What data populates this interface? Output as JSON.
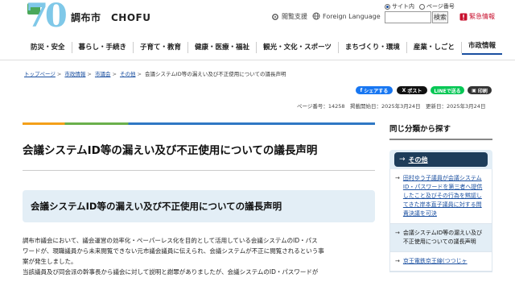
{
  "header": {
    "logo_number": "70",
    "city_name": "調布市　CHOFU",
    "radio_site": "サイト内",
    "radio_page": "ページ番号",
    "reading_support": "閲覧支援",
    "foreign_language": "Foreign Language",
    "search_placeholder": "",
    "search_button": "検索",
    "emergency": "緊急情報"
  },
  "gnav": {
    "items": [
      "防災・安全",
      "暮らし・手続き",
      "子育て・教育",
      "健康・医療・福祉",
      "観光・文化・スポーツ",
      "まちづくり・環境",
      "産業・しごと",
      "市政情報"
    ]
  },
  "breadcrumb": {
    "items": [
      "トップページ",
      "市政情報",
      "市議会",
      "その他"
    ],
    "current": "会議システムID等の漏えい及び不正使用についての議長声明"
  },
  "share": {
    "facebook": "シェアする",
    "x": "ポスト",
    "line": "LINEで送る",
    "print": "印刷"
  },
  "meta": {
    "text": "ページ番号：14258　掲載開始日：2025年3月24日　更新日：2025年3月24日"
  },
  "main": {
    "title": "会議システムID等の漏えい及び不正使用についての議長声明",
    "heading": "会議システムID等の漏えい及び不正使用についての議長声明",
    "para1_line1": "調布市議会において、議会運営の効率化・ペーパーレス化を目的として活用している会議システムのID・パス",
    "para1_line2": "ワードが、現職議員から未来閲覧できない元市議会議員に伝えられ、会議システムが不正に閲覧されるという事",
    "para1_line3": "案が発生しました。",
    "para2_line1": "当該議員及び同会派の幹事長から議会に対して説明と謝罪がありましたが、会議システムのID・パスワードが"
  },
  "side": {
    "heading": "同じ分類から探す",
    "category": "その他",
    "items": [
      {
        "text": "田村ゆう子議員が会議システムID・パスワードを第三者へ提供したこと及びその行為を黙認してきた岸本直子議員に対する問責決議を可決",
        "current": false
      },
      {
        "text": "会議システムID等の漏えい及び不正使用についての議長声明",
        "current": true
      },
      {
        "text": "京王電鉄京王線(つつじヶ",
        "current": false
      }
    ]
  },
  "colors": {
    "brand_blue": "#1a4fa0",
    "emergency_red": "#c8102e",
    "light_blue_bg": "#e3eef6",
    "sidebar_dark": "#1e3d5a",
    "facebook": "#1877f2",
    "x": "#111111",
    "line": "#06c755",
    "print": "#333333"
  }
}
